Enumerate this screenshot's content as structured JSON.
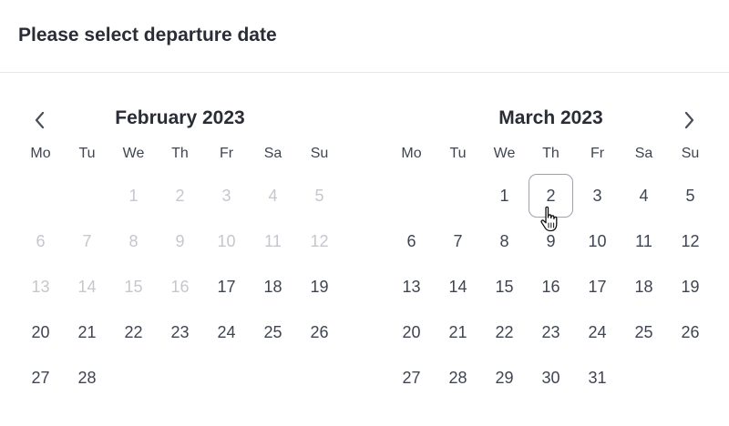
{
  "header": {
    "title": "Please select departure date"
  },
  "weekdays": [
    "Mo",
    "Tu",
    "We",
    "Th",
    "Fr",
    "Sa",
    "Su"
  ],
  "months": [
    {
      "title": "February 2023",
      "leading_blanks": 2,
      "days": [
        {
          "d": "1",
          "disabled": true
        },
        {
          "d": "2",
          "disabled": true
        },
        {
          "d": "3",
          "disabled": true
        },
        {
          "d": "4",
          "disabled": true
        },
        {
          "d": "5",
          "disabled": true
        },
        {
          "d": "6",
          "disabled": true
        },
        {
          "d": "7",
          "disabled": true
        },
        {
          "d": "8",
          "disabled": true
        },
        {
          "d": "9",
          "disabled": true
        },
        {
          "d": "10",
          "disabled": true
        },
        {
          "d": "11",
          "disabled": true
        },
        {
          "d": "12",
          "disabled": true
        },
        {
          "d": "13",
          "disabled": true
        },
        {
          "d": "14",
          "disabled": true
        },
        {
          "d": "15",
          "disabled": true
        },
        {
          "d": "16",
          "disabled": true
        },
        {
          "d": "17"
        },
        {
          "d": "18"
        },
        {
          "d": "19"
        },
        {
          "d": "20"
        },
        {
          "d": "21"
        },
        {
          "d": "22"
        },
        {
          "d": "23"
        },
        {
          "d": "24"
        },
        {
          "d": "25"
        },
        {
          "d": "26"
        },
        {
          "d": "27"
        },
        {
          "d": "28"
        }
      ]
    },
    {
      "title": "March 2023",
      "leading_blanks": 2,
      "days": [
        {
          "d": "1"
        },
        {
          "d": "2",
          "hovered": true
        },
        {
          "d": "3"
        },
        {
          "d": "4"
        },
        {
          "d": "5"
        },
        {
          "d": "6"
        },
        {
          "d": "7"
        },
        {
          "d": "8"
        },
        {
          "d": "9"
        },
        {
          "d": "10"
        },
        {
          "d": "11"
        },
        {
          "d": "12"
        },
        {
          "d": "13"
        },
        {
          "d": "14"
        },
        {
          "d": "15"
        },
        {
          "d": "16"
        },
        {
          "d": "17"
        },
        {
          "d": "18"
        },
        {
          "d": "19"
        },
        {
          "d": "20"
        },
        {
          "d": "21"
        },
        {
          "d": "22"
        },
        {
          "d": "23"
        },
        {
          "d": "24"
        },
        {
          "d": "25"
        },
        {
          "d": "26"
        },
        {
          "d": "27"
        },
        {
          "d": "28"
        },
        {
          "d": "29"
        },
        {
          "d": "30"
        },
        {
          "d": "31"
        }
      ]
    }
  ],
  "icons": {
    "prev": "chevron-left-icon",
    "next": "chevron-right-icon",
    "cursor": "hand-pointer-cursor-icon"
  },
  "colors": {
    "text": "#3f4451",
    "title": "#2a2d36",
    "disabled": "#c5c7cc",
    "divider": "#e6e7ea",
    "hover_border": "#9ea1a8"
  }
}
